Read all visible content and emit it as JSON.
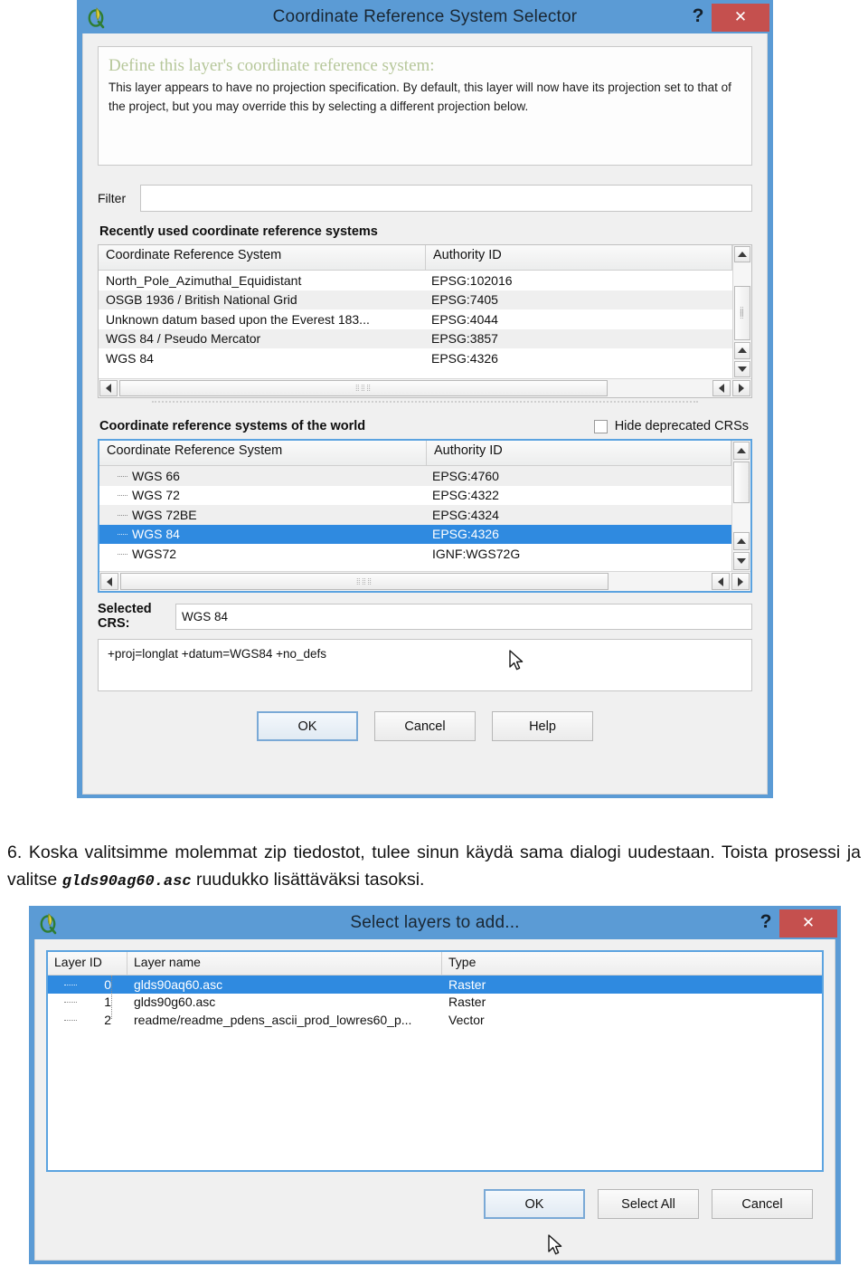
{
  "crs_dialog": {
    "title": "Coordinate Reference System Selector",
    "app_icon": "qgis-icon",
    "help_button": "?",
    "close_button": "✕",
    "description": {
      "heading": "Define this layer's coordinate reference system:",
      "body": "This layer appears to have no projection specification. By default, this layer will now have its projection set to that of the project, but you may override this by selecting a different projection below."
    },
    "filter": {
      "label": "Filter",
      "value": "",
      "placeholder": ""
    },
    "recent": {
      "group_label": "Recently used coordinate reference systems",
      "columns": [
        "Coordinate Reference System",
        "Authority ID"
      ],
      "rows": [
        {
          "crs": "North_Pole_Azimuthal_Equidistant",
          "authority": "EPSG:102016"
        },
        {
          "crs": "OSGB 1936 / British National Grid",
          "authority": "EPSG:7405"
        },
        {
          "crs": "Unknown datum based upon the Everest 183...",
          "authority": "EPSG:4044"
        },
        {
          "crs": "WGS 84 / Pseudo Mercator",
          "authority": "EPSG:3857"
        },
        {
          "crs": "WGS 84",
          "authority": "EPSG:4326"
        }
      ]
    },
    "world": {
      "group_label": "Coordinate reference systems of the world",
      "hide_deprecated_label": "Hide deprecated CRSs",
      "hide_deprecated_checked": false,
      "columns": [
        "Coordinate Reference System",
        "Authority ID"
      ],
      "rows": [
        {
          "crs": "WGS 66",
          "authority": "EPSG:4760",
          "selected": false
        },
        {
          "crs": "WGS 72",
          "authority": "EPSG:4322",
          "selected": false
        },
        {
          "crs": "WGS 72BE",
          "authority": "EPSG:4324",
          "selected": false
        },
        {
          "crs": "WGS 84",
          "authority": "EPSG:4326",
          "selected": true
        },
        {
          "crs": "WGS72",
          "authority": "IGNF:WGS72G",
          "selected": false
        }
      ]
    },
    "selected_crs": {
      "label": "Selected CRS:",
      "value": "WGS 84"
    },
    "proj_string": "+proj=longlat +datum=WGS84 +no_defs",
    "buttons": {
      "ok": "OK",
      "cancel": "Cancel",
      "help": "Help"
    }
  },
  "paragraph": {
    "number": "6.",
    "part1": "Koska valitsimme molemmat zip tiedostot, tulee sinun käydä sama dialogi uudestaan. Toista prosessi ja valitse ",
    "code": "glds90ag60.asc",
    "part2": " ruudukko lisättäväksi tasoksi."
  },
  "layers_dialog": {
    "title": "Select layers to add...",
    "app_icon": "qgis-icon",
    "help_button": "?",
    "close_button": "✕",
    "columns": [
      "Layer ID",
      "Layer name",
      "Type"
    ],
    "rows": [
      {
        "id": "0",
        "name": "glds90aq60.asc",
        "type": "Raster",
        "selected": true
      },
      {
        "id": "1",
        "name": "glds90g60.asc",
        "type": "Raster",
        "selected": false
      },
      {
        "id": "2",
        "name": "readme/readme_pdens_ascii_prod_lowres60_p...",
        "type": "Vector",
        "selected": false
      }
    ],
    "buttons": {
      "ok": "OK",
      "select_all": "Select All",
      "cancel": "Cancel"
    }
  },
  "colors": {
    "titlebar_blue": "#5b9bd5",
    "close_red": "#c5504e",
    "selection_blue": "#2f8ae0",
    "focus_border": "#5ba3e0",
    "heading_green": "#b6c79a"
  }
}
